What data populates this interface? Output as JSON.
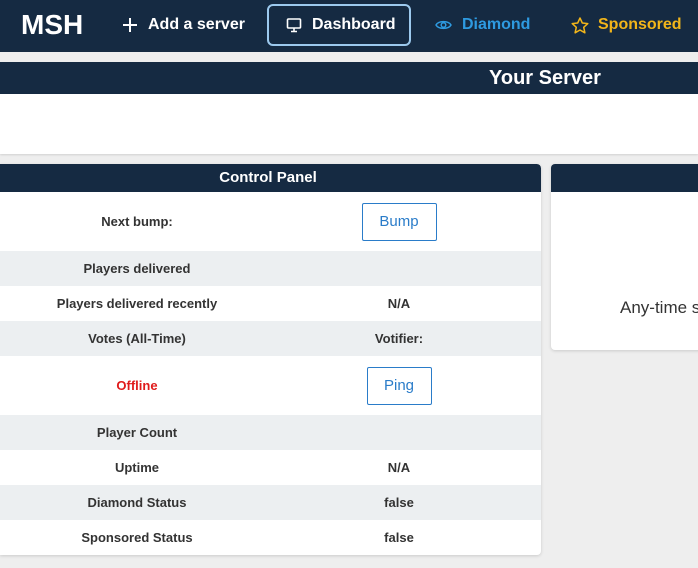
{
  "nav": {
    "brand": "MSH",
    "add_server": "Add a server",
    "dashboard": "Dashboard",
    "diamond": "Diamond",
    "sponsored": "Sponsored"
  },
  "server": {
    "title": "Your Server"
  },
  "control_panel": {
    "title": "Control Panel",
    "rows": [
      {
        "label": "Next bump:",
        "value": "",
        "button": "Bump"
      },
      {
        "label": "Players delivered",
        "value": ""
      },
      {
        "label": "Players delivered recently",
        "value": "N/A"
      },
      {
        "label": "Votes (All-Time)",
        "value": "Votifier:"
      },
      {
        "label": "Offline",
        "value": "",
        "button": "Ping"
      },
      {
        "label": "Player Count",
        "value": ""
      },
      {
        "label": "Uptime",
        "value": "N/A"
      },
      {
        "label": "Diamond Status",
        "value": "false"
      },
      {
        "label": "Sponsored Status",
        "value": "false"
      }
    ]
  },
  "side_card": {
    "text": "Any-time s"
  },
  "colors": {
    "navy": "#152a42",
    "diamond": "#2e9ae0",
    "sponsored": "#f2b51a",
    "offline": "#e01b1b",
    "button_blue": "#2a7cc9"
  },
  "icons": {
    "add": "plus-icon",
    "dashboard": "monitor-icon",
    "diamond": "eye-icon",
    "sponsored": "star-icon"
  }
}
